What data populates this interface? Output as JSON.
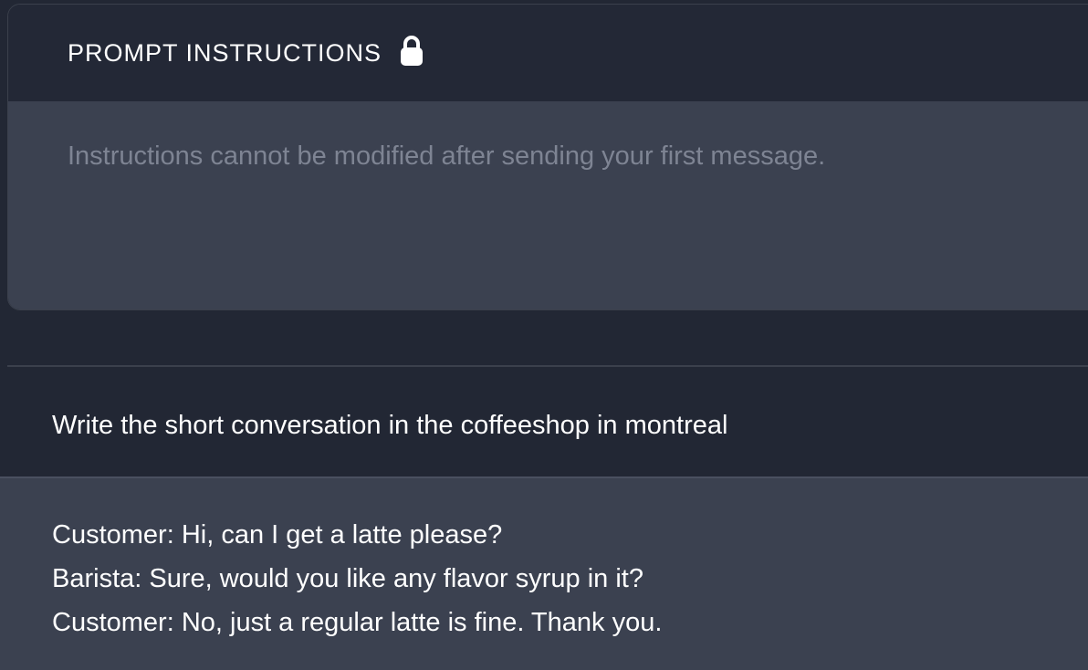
{
  "prompt_instructions": {
    "title": "PROMPT INSTRUCTIONS",
    "icon": "lock-icon",
    "placeholder": "Instructions cannot be modified after sending your first message."
  },
  "conversation": {
    "user_message": "Write the short conversation in the coffeeshop in montreal",
    "assistant_lines": [
      "Customer: Hi, can I get a latte please?",
      "Barista: Sure, would you like any flavor syrup in it?",
      "Customer: No, just a regular latte is fine. Thank you."
    ]
  },
  "colors": {
    "background": "#222734",
    "panel": "#3b4150",
    "placeholder_text": "#7e8493",
    "text": "#ffffff"
  }
}
